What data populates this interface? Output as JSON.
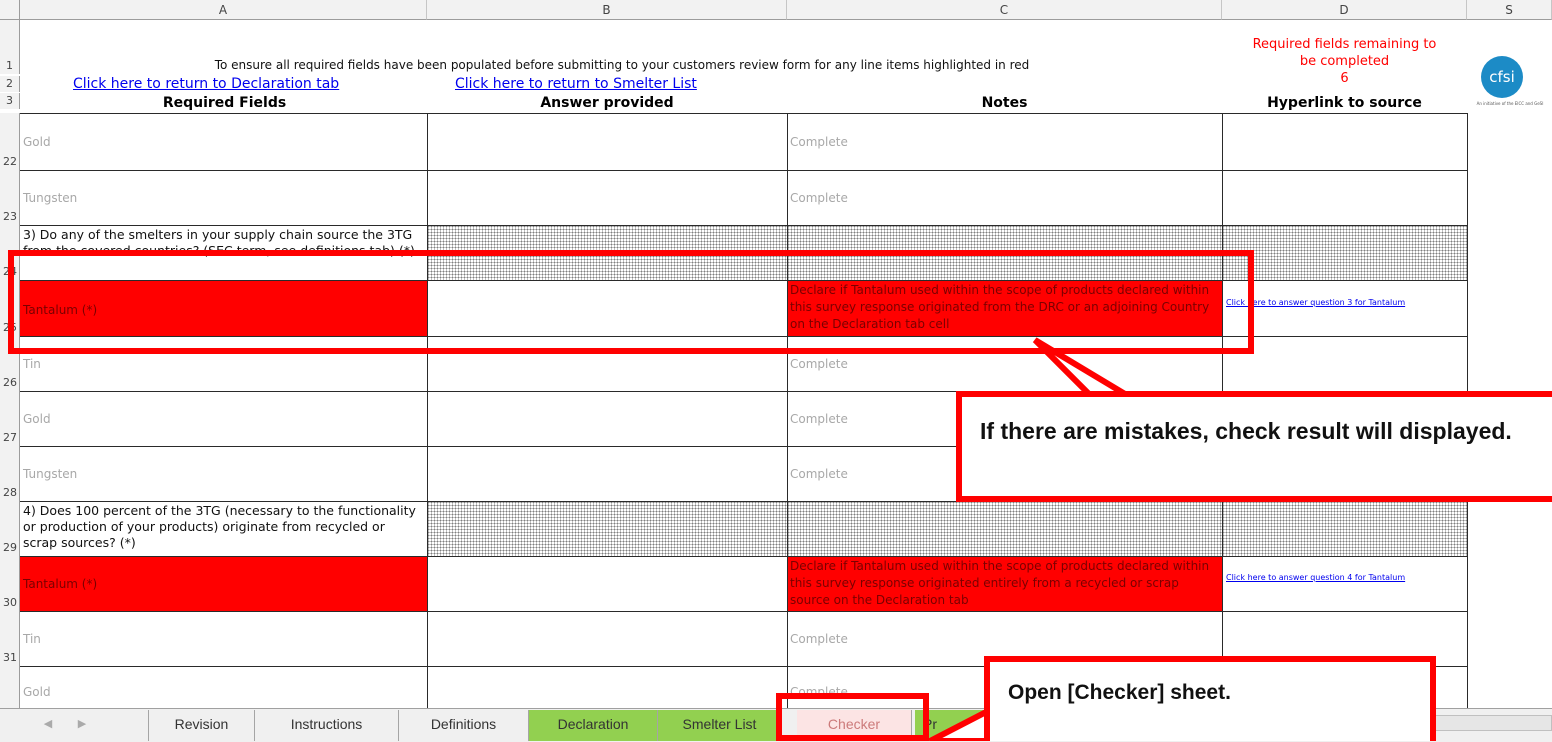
{
  "columns": [
    "A",
    "B",
    "C",
    "D",
    "S"
  ],
  "header": {
    "row_numbers": [
      "1",
      "2",
      "3"
    ],
    "instruction": "To ensure all required fields have been populated before submitting to your customers review form for any line items highlighted in red",
    "link_declaration": "Click here to return to Declaration tab",
    "link_smelter": "Click here to return to Smelter List",
    "required_remaining_line1": "Required fields remaining to",
    "required_remaining_line2": "be completed",
    "required_remaining_count": "6",
    "col_a_title": "Required Fields",
    "col_b_title": "Answer provided",
    "col_c_title": "Notes",
    "col_d_title": "Hyperlink to source",
    "logo_text": "cfsi",
    "logo_caption": "An initiative of the EICC and GeSI",
    "logo_color": "#1c8bc6"
  },
  "rows": {
    "r22": {
      "num": "22",
      "a": "Gold",
      "c": "Complete"
    },
    "r23": {
      "num": "23",
      "a": "Tungsten",
      "c": "Complete"
    },
    "r24": {
      "num": "24",
      "a": "3) Do any of the smelters in your supply chain source the 3TG from the covered countries? (SEC term, see definitions tab) (*)"
    },
    "r25": {
      "num": "25",
      "a": "Tantalum  (*)",
      "c": "Declare if Tantalum used within the scope of products declared within this survey response originated from the DRC or an adjoining Country on the Declaration tab cell",
      "d": "Click here to answer question 3 for Tantalum"
    },
    "r26": {
      "num": "26",
      "a": "Tin",
      "c": "Complete"
    },
    "r27": {
      "num": "27",
      "a": "Gold",
      "c": "Complete"
    },
    "r28": {
      "num": "28",
      "a": "Tungsten",
      "c": "Complete"
    },
    "r29": {
      "num": "29",
      "a": "4) Does 100 percent of the 3TG (necessary to the functionality or production of your products) originate from recycled or scrap sources?  (*)"
    },
    "r30": {
      "num": "30",
      "a": "Tantalum  (*)",
      "c": "Declare if Tantalum used within the scope of products declared within this survey response originated entirely from a recycled or scrap source on the Declaration tab",
      "d": "Click here to answer question 4 for Tantalum"
    },
    "r31": {
      "num": "31",
      "a": "Tin",
      "c": "Complete"
    },
    "r32": {
      "a": "Gold",
      "c": "Complete"
    }
  },
  "tabs": {
    "revision": "Revision",
    "instructions": "Instructions",
    "definitions": "Definitions",
    "declaration": "Declaration",
    "smelter_list": "Smelter List",
    "checker": "Checker",
    "next_partial": "Pr"
  },
  "callouts": {
    "mistakes": "If there are mistakes, check result will displayed.",
    "open_checker": "Open [Checker] sheet."
  },
  "colors": {
    "error_fill": "#ff0000",
    "tab_green": "#92d050",
    "highlight_border": "#ff0000"
  }
}
